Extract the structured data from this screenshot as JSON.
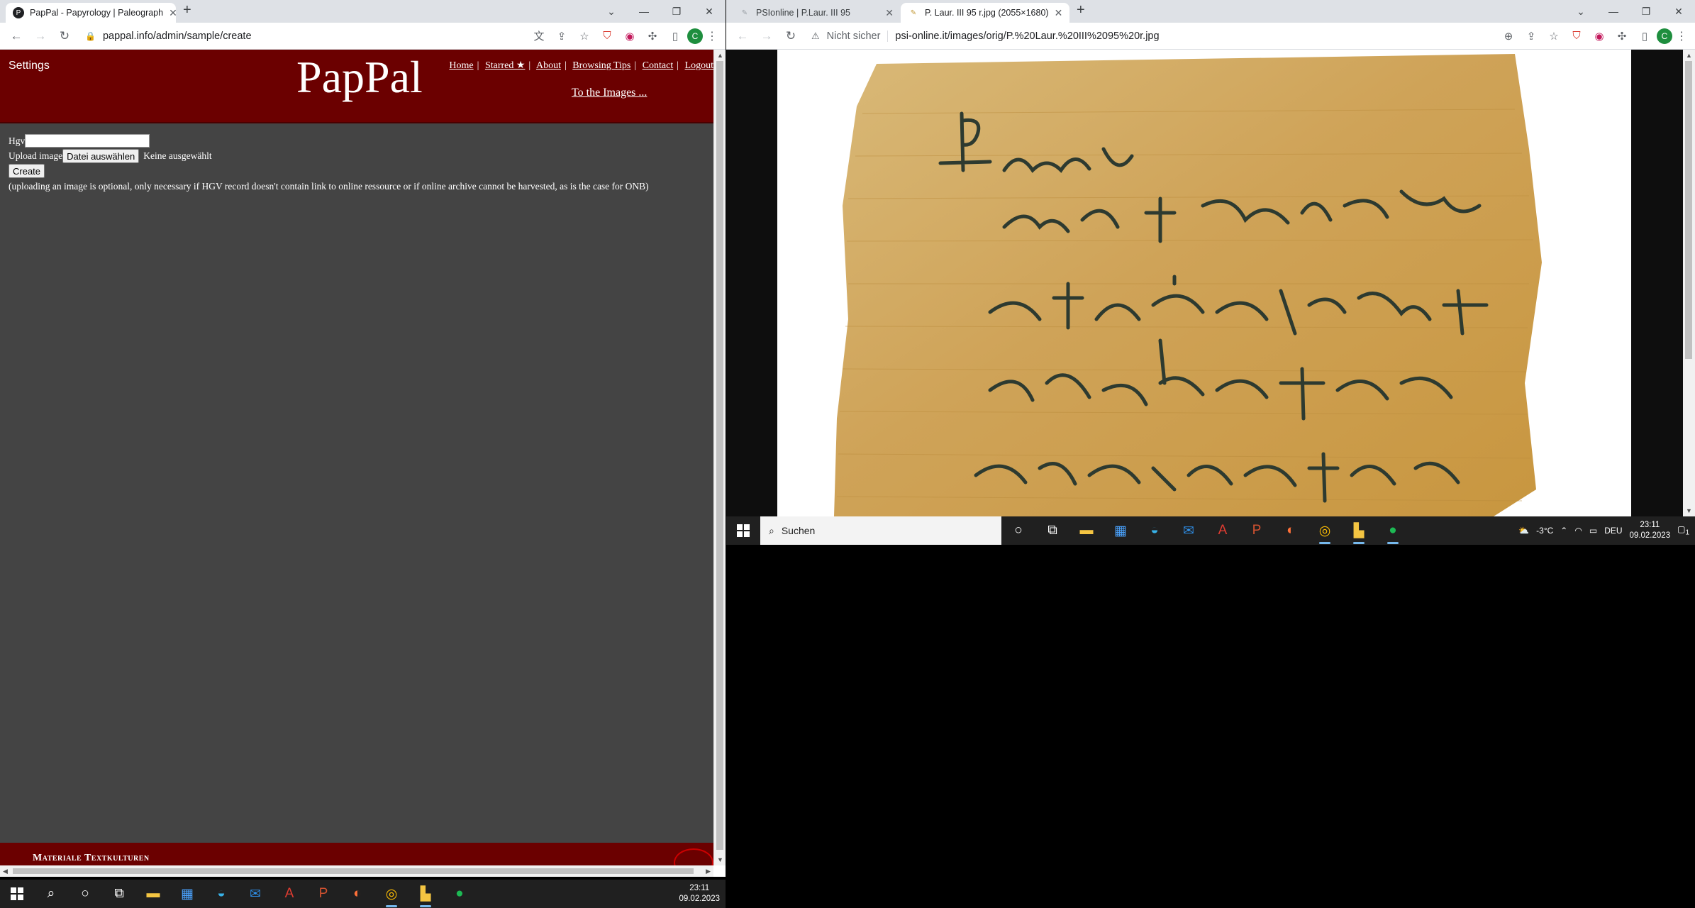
{
  "left_window": {
    "tab": {
      "title": "PapPal - Papyrology | Paleograph",
      "close": "✕"
    },
    "new_tab": "+",
    "url": "pappal.info/admin/sample/create",
    "window_controls": [
      "⌄",
      "—",
      "❐",
      "✕"
    ],
    "avatar_letter": "C",
    "page": {
      "settings": "Settings",
      "logo": "PapPal",
      "nav": [
        "Home",
        "Starred ★",
        "About",
        "Browsing Tips",
        "Contact",
        "Logout"
      ],
      "nav_sep": "|",
      "to_images": "To the Images ...",
      "form": {
        "hgv_label": "Hgv",
        "upload_label": "Upload image",
        "file_button": "Datei auswählen",
        "file_status": "Keine ausgewählt",
        "create_button": "Create",
        "note": "(uploading an image is optional, only necessary if HGV record doesn't contain link to online ressource or if online archive cannot be harvested, as is the case for ONB)"
      },
      "footer": "Materiale Textkulturen"
    }
  },
  "right_window": {
    "tabs": [
      {
        "title": "PSIonline | P.Laur. III 95",
        "active": false
      },
      {
        "title": "P. Laur. III 95 r.jpg (2055×1680)",
        "active": true
      }
    ],
    "new_tab": "+",
    "security": "Nicht sicher",
    "url": "psi-online.it/images/orig/P.%20Laur.%20III%2095%20r.jpg",
    "avatar_letter": "C",
    "image_alt": "Papyrus fragment P. Laur. III 95 recto"
  },
  "taskbar_left": {
    "clock_time": "23:11",
    "clock_date": "09.02.2023"
  },
  "taskbar_right": {
    "search_placeholder": "Suchen",
    "weather": "-3°C",
    "language": "DEU",
    "clock_time": "23:11",
    "clock_date": "09.02.2023",
    "notification_count": "1"
  }
}
